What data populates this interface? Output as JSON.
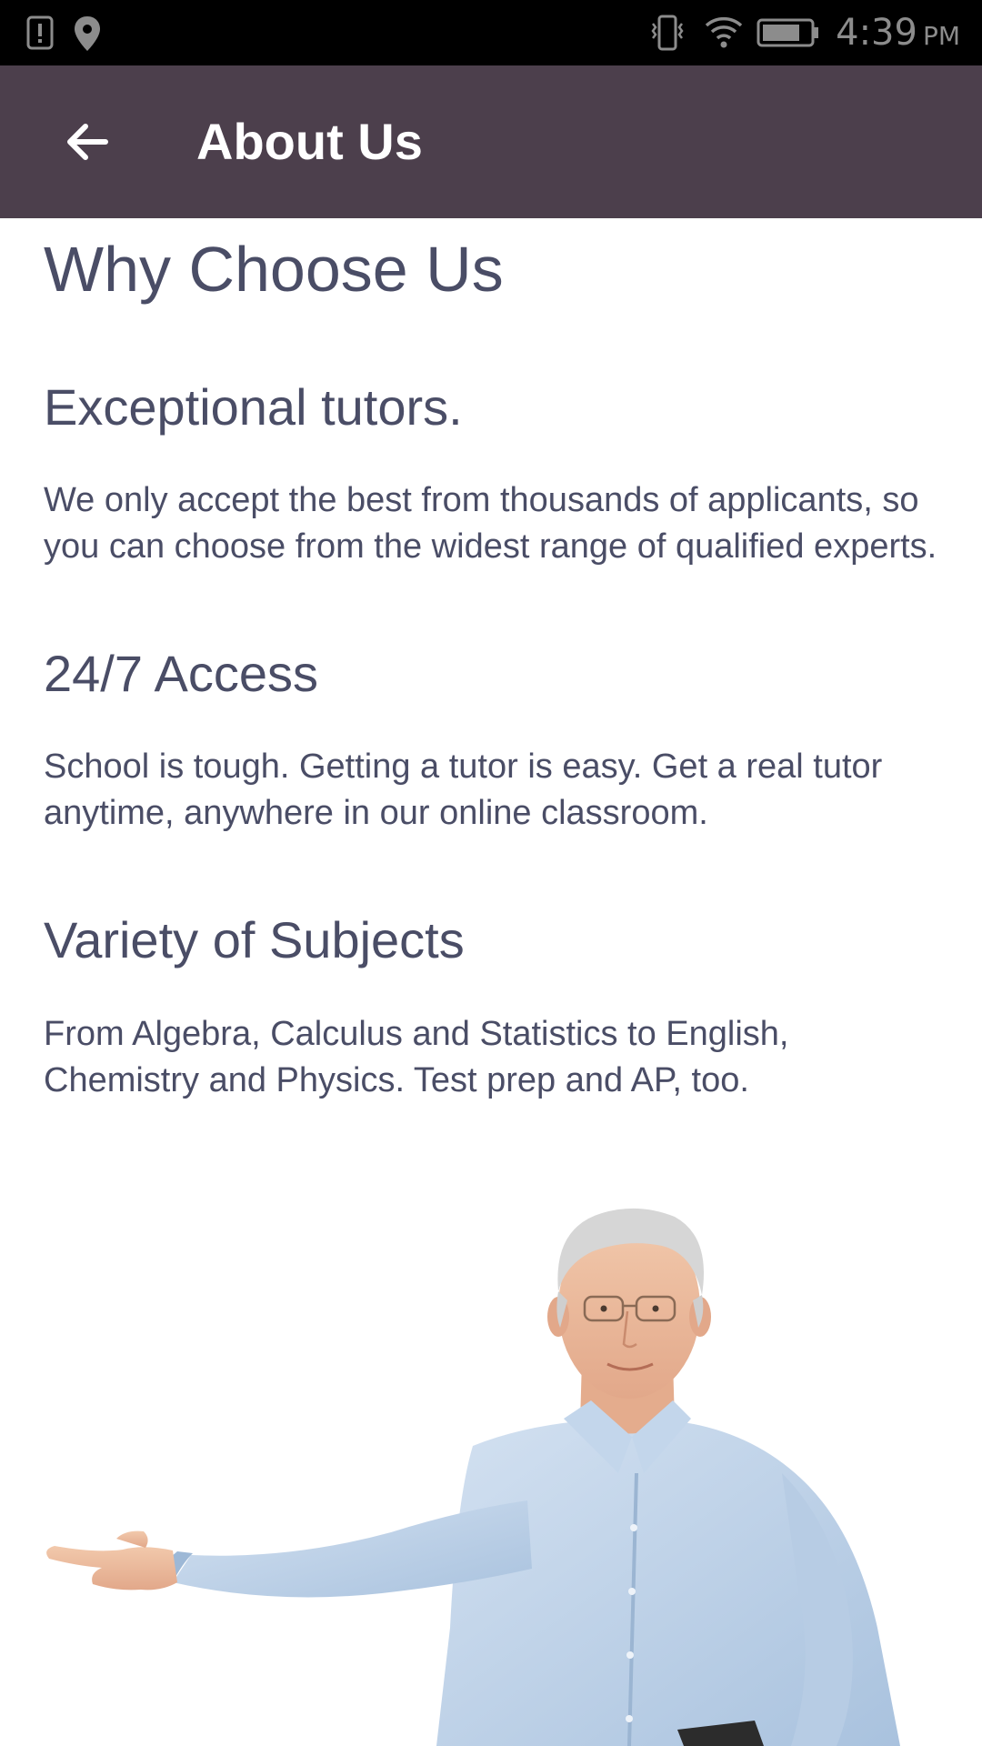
{
  "status_bar": {
    "time": "4:39",
    "ampm": "PM",
    "icons": [
      "notification-alert-icon",
      "location-pin-icon",
      "vibrate-icon",
      "wifi-icon",
      "battery-icon"
    ]
  },
  "app_bar": {
    "title": "About Us",
    "back_icon": "arrow-left-icon",
    "background": "#4c3f4c"
  },
  "content": {
    "heading": "Why Choose Us",
    "sections": [
      {
        "title": "Exceptional tutors.",
        "text": "We only accept the best from thousands of applicants, so you can choose from the widest range of qualified experts."
      },
      {
        "title": "24/7 Access",
        "text": "School is tough. Getting a tutor is easy. Get a real tutor anytime, anywhere in our online classroom."
      },
      {
        "title": "Variety of Subjects",
        "text": "From Algebra, Calculus and Statistics to English, Chemistry and Physics. Test prep and AP, too."
      }
    ],
    "text_color": "#4a4d66"
  },
  "image": {
    "subject": "teacher-illustration"
  }
}
